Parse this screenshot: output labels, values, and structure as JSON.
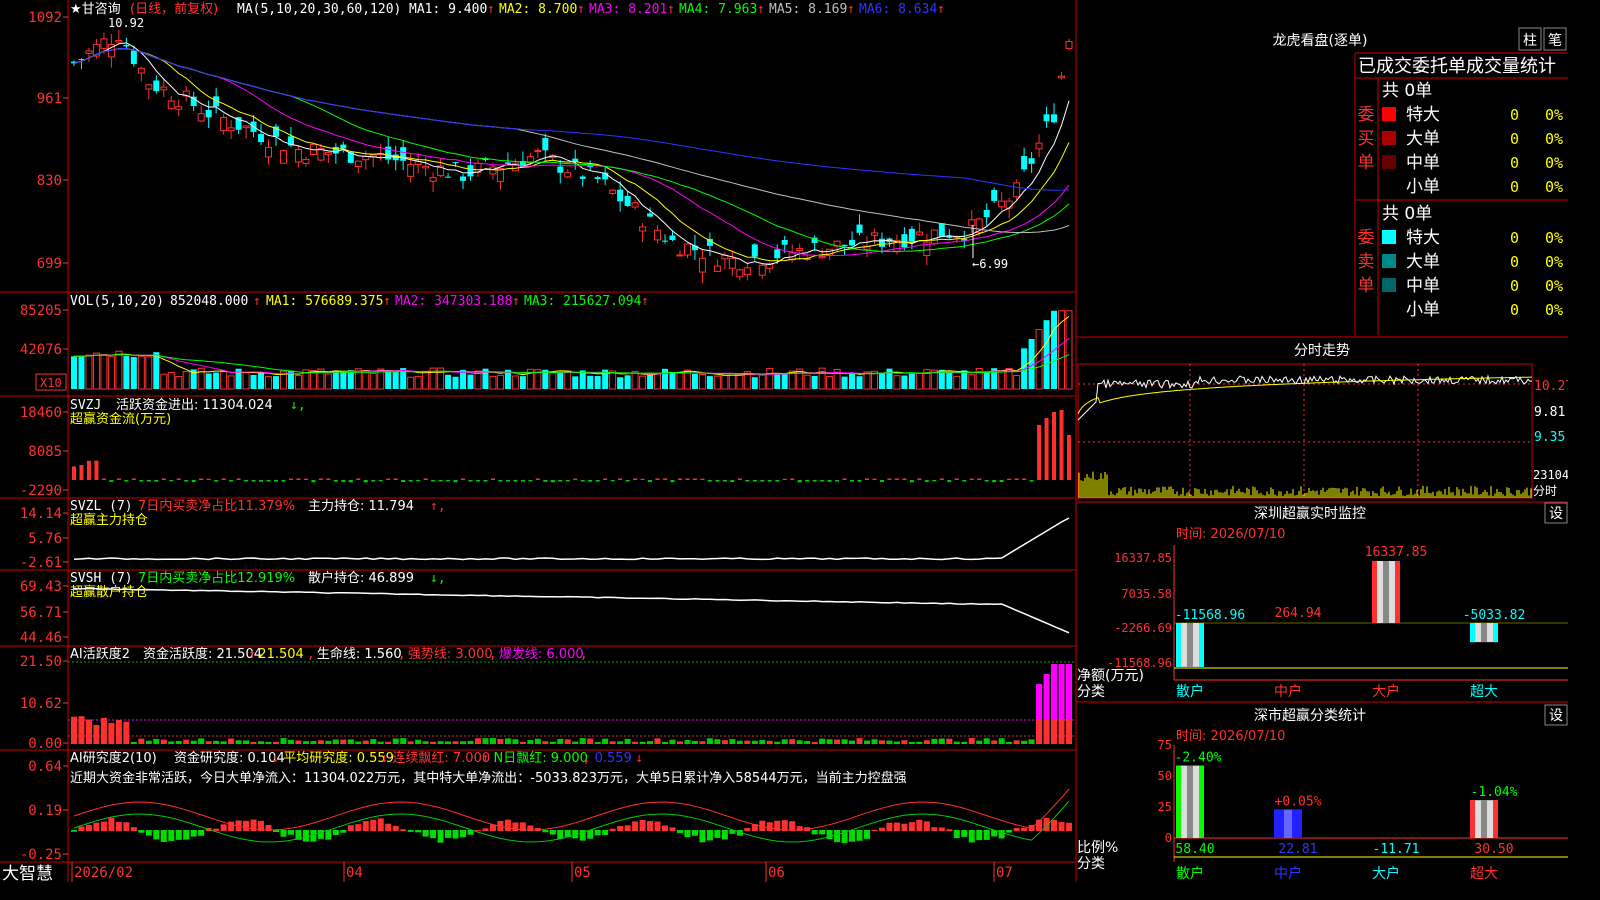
{
  "stock": {
    "name": "甘咨询",
    "period_label": "(日线，前复权)",
    "star": "★"
  },
  "main": {
    "ma_header": "MA(5,10,20,30,60,120)",
    "ma_items": [
      {
        "label": "MA1: 9.400",
        "arrow": "↑",
        "color": "#ffffff"
      },
      {
        "label": "MA2: 8.700",
        "arrow": "↑",
        "color": "#ffff00"
      },
      {
        "label": "MA3: 8.201",
        "arrow": "↑",
        "color": "#ff00ff"
      },
      {
        "label": "MA4: 7.963",
        "arrow": "↑",
        "color": "#00ff00"
      },
      {
        "label": "MA5: 8.169",
        "arrow": "↑",
        "color": "#c0c0c0"
      },
      {
        "label": "MA6: 8.634",
        "arrow": "↑",
        "color": "#3333ff"
      }
    ],
    "y_ticks": [
      "1092",
      "961",
      "830",
      "699"
    ],
    "high_label": "10.92",
    "low_label": "←6.99"
  },
  "vol": {
    "header": "VOL(5,10,20)",
    "value": "852048.000",
    "items": [
      {
        "label": "MA1: 576689.375",
        "color": "#ffff00"
      },
      {
        "label": "MA2: 347303.188",
        "color": "#ff00ff"
      },
      {
        "label": "MA3: 215627.094",
        "color": "#00ff00"
      }
    ],
    "y_ticks": [
      "85205",
      "42076"
    ],
    "unit": "X10"
  },
  "svzj": {
    "header": "SVZJ",
    "line1": "活跃资金进出: 11304.024",
    "line2": "超赢资金流(万元)",
    "y_ticks": [
      "18460",
      "8085",
      "-2290"
    ]
  },
  "svzl": {
    "header": "SVZL (7)",
    "stat": "7日内买卖净占比11.379%",
    "line1": "主力持仓: 11.794",
    "line2": "超赢主力持仓",
    "y_ticks": [
      "14.14",
      "5.76",
      "-2.61"
    ]
  },
  "svsh": {
    "header": "SVSH (7)",
    "stat": "7日内买卖净占比12.919%",
    "line1": "散户持仓: 46.899",
    "line2": "超赢散户持仓",
    "y_ticks": [
      "69.43",
      "56.71",
      "44.46"
    ]
  },
  "ai1": {
    "header": "AI活跃度2",
    "items": [
      {
        "label": "资金活跃度: 21.504",
        "arrow": "↑",
        "color": "#ffffff"
      },
      {
        "label": "21.504",
        "arrow": ",",
        "color": "#ffff00"
      },
      {
        "label": "生命线: 1.560",
        "arrow": ",",
        "color": "#ffffff"
      },
      {
        "label": "强势线: 3.000",
        "arrow": ",",
        "color": "#ff3333"
      },
      {
        "label": "爆发线: 6.000",
        "arrow": ",",
        "color": "#ff00ff"
      }
    ],
    "y_ticks": [
      "21.50",
      "10.62",
      "0.00"
    ]
  },
  "ai2": {
    "header": "AI研究度2(10)",
    "items": [
      {
        "label": "资金研究度: 0.104",
        "arrow": "↓",
        "color": "#ffffff"
      },
      {
        "label": "平均研究度: 0.559",
        "arrow": "↓",
        "color": "#ffff00"
      },
      {
        "label": "连续飘红: 7.000",
        "arrow": "↑",
        "color": "#ff3333"
      },
      {
        "label": "N日飘红: 9.000",
        "arrow": ",",
        "color": "#00ff00"
      },
      {
        "label": "0.559",
        "arrow": "↓",
        "color": "#3333ff"
      }
    ],
    "comment": "近期大资金非常活跃，今日大单净流入：11304.022万元，其中特大单净流出：-5033.823万元，大单5日累计净入58544万元，当前主力控盘强",
    "y_ticks": [
      "0.64",
      "0.19",
      "-0.25"
    ]
  },
  "timeline": {
    "labels": [
      "2026/02",
      "04",
      "05",
      "06",
      "07"
    ]
  },
  "brand": "大智慧",
  "right": {
    "title": "龙虎看盘(逐单)",
    "btn_zhu": "柱",
    "btn_bi": "笔",
    "table_header": "已成交委托单成交量统计",
    "buy": {
      "side_label": "委买单",
      "total": "共 0单",
      "rows": [
        {
          "label": "特大",
          "v": "0",
          "p": "0%",
          "color": "#ff0000"
        },
        {
          "label": "大单",
          "v": "0",
          "p": "0%",
          "color": "#aa0000"
        },
        {
          "label": "中单",
          "v": "0",
          "p": "0%",
          "color": "#660000"
        },
        {
          "label": "小单",
          "v": "0",
          "p": "0%",
          "color": "#000000"
        }
      ]
    },
    "sell": {
      "side_label": "委卖单",
      "total": "共 0单",
      "rows": [
        {
          "label": "特大",
          "v": "0",
          "p": "0%",
          "color": "#00ffff"
        },
        {
          "label": "大单",
          "v": "0",
          "p": "0%",
          "color": "#008888"
        },
        {
          "label": "中单",
          "v": "0",
          "p": "0%",
          "color": "#006666"
        },
        {
          "label": "小单",
          "v": "0",
          "p": "0%",
          "color": "#000000"
        }
      ]
    },
    "intraday": {
      "title": "分时走势",
      "y_ticks": [
        "10.27",
        "9.81",
        "9.35"
      ],
      "vol_label": "23104",
      "vol_unit": "分时"
    },
    "monitor": {
      "title": "深圳超赢实时监控",
      "settings": "设",
      "time": "时间: 2026/07/10",
      "y_ticks": [
        "16337.85",
        "7035.58",
        "-2266.69",
        "-11568.96"
      ],
      "y_title": "净额(万元)",
      "x_title": "分类",
      "categories": [
        "散户",
        "中户",
        "大户",
        "超大"
      ],
      "values": [
        -11568.96,
        264.94,
        16337.85,
        -5033.82
      ],
      "value_labels": [
        "-11568.96",
        "264.94",
        "16337.85",
        "-5033.82"
      ]
    },
    "stats": {
      "title": "深市超赢分类统计",
      "settings": "设",
      "time": "时间: 2026/07/10",
      "y_ticks": [
        "75",
        "50",
        "25",
        "0"
      ],
      "y_title": "比例%",
      "x_title": "分类",
      "categories": [
        "散户",
        "中户",
        "大户",
        "超大"
      ],
      "values": [
        58.4,
        22.81,
        -11.71,
        30.5
      ],
      "value_labels": [
        "58.40",
        "22.81",
        "-11.71",
        "30.50"
      ],
      "change_labels": [
        "-2.40%",
        "+0.05%",
        "",
        "-1.04%"
      ]
    }
  },
  "chart_data": {
    "type": "candlestick",
    "x_range": [
      "2026/02",
      "2026/07"
    ],
    "price_range": [
      6.99,
      10.92
    ],
    "last_price_hint": 9.4,
    "ohlc_anchor_points": [
      {
        "i": 0,
        "c": 10.4
      },
      {
        "i": 6,
        "c": 10.9
      },
      {
        "i": 10,
        "c": 10.1
      },
      {
        "i": 18,
        "c": 9.6
      },
      {
        "i": 30,
        "c": 9.0
      },
      {
        "i": 40,
        "c": 8.9
      },
      {
        "i": 52,
        "c": 8.6
      },
      {
        "i": 62,
        "c": 8.9
      },
      {
        "i": 70,
        "c": 8.5
      },
      {
        "i": 80,
        "c": 7.5
      },
      {
        "i": 88,
        "c": 7.2
      },
      {
        "i": 100,
        "c": 7.4
      },
      {
        "i": 112,
        "c": 7.6
      },
      {
        "i": 120,
        "c": 7.7
      },
      {
        "i": 126,
        "c": 8.3
      },
      {
        "i": 131,
        "c": 9.6
      },
      {
        "i": 133,
        "c": 10.8
      }
    ]
  }
}
